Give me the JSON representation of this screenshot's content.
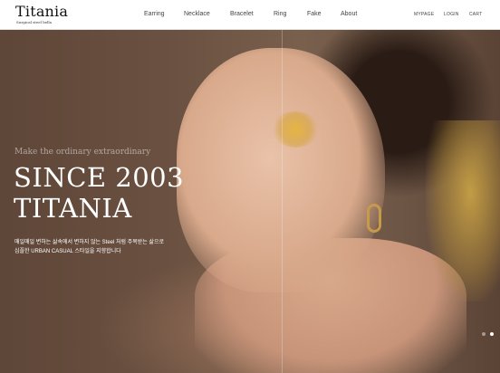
{
  "brand": {
    "logo": "Titania",
    "tagline": "Surgical steel bella"
  },
  "nav": {
    "items": [
      {
        "label": "Earring"
      },
      {
        "label": "Necklace"
      },
      {
        "label": "Bracelet"
      },
      {
        "label": "Ring"
      },
      {
        "label": "Fake"
      },
      {
        "label": "About"
      }
    ]
  },
  "utility": {
    "mypage": "MYPAGE",
    "login": "LOGIN",
    "cart": "CART"
  },
  "hero": {
    "slogan": "Make the ordinary extraordinary",
    "headline_line1": "SINCE 2003",
    "headline_line2": "TITANIA",
    "desc_line1": "매일매일 변하는 삶속에서 변하지 않는 Steel 처럼 주목받는 삶으로",
    "desc_line2": "심플한 URBAN CASUAL 스타일을 지향합니다",
    "slides_total": 2,
    "slide_active": 2
  },
  "colors": {
    "header_bg": "#ffffff",
    "hero_text": "#ffffff",
    "accent_gold": "#c79a4a"
  }
}
